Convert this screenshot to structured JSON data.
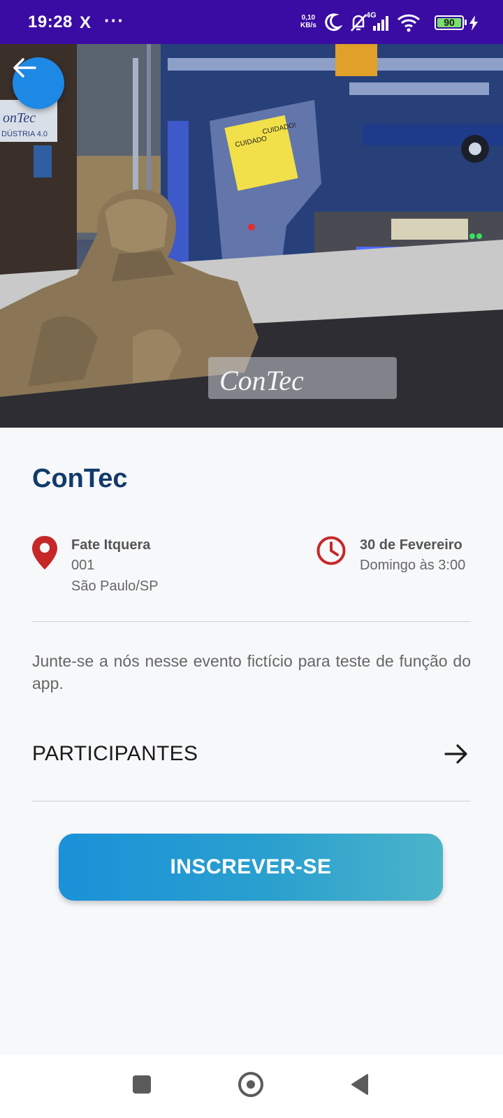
{
  "status_bar": {
    "time": "19:28",
    "x_icon": "X",
    "more": "···",
    "speed_value": "0,10",
    "speed_unit": "KB/s",
    "network": "4G",
    "battery": "90",
    "background_color": "#3a0ca3"
  },
  "hero": {
    "image_text": "ConTec",
    "back_icon": "arrow-left-icon",
    "accent_color": "#1e88e5"
  },
  "event": {
    "title": "ConTec",
    "location": {
      "icon": "map-pin-icon",
      "name": "Fate Itquera",
      "number": "001",
      "city": "São Paulo/SP"
    },
    "schedule": {
      "icon": "clock-icon",
      "date": "30 de Fevereiro",
      "time": "Domingo às 3:00"
    },
    "description": "Junte-se a nós nesse evento fictício para teste de função do app.",
    "participants_label": "PARTICIPANTES",
    "participants_icon": "arrow-right-icon",
    "subscribe_label": "INSCREVER-SE"
  },
  "colors": {
    "title": "#123a6b",
    "icons": "#c62828",
    "button": "#1a91d8"
  },
  "nav_bar": {
    "recents_icon": "square-icon",
    "home_icon": "circle-icon",
    "back_icon": "triangle-back-icon"
  }
}
